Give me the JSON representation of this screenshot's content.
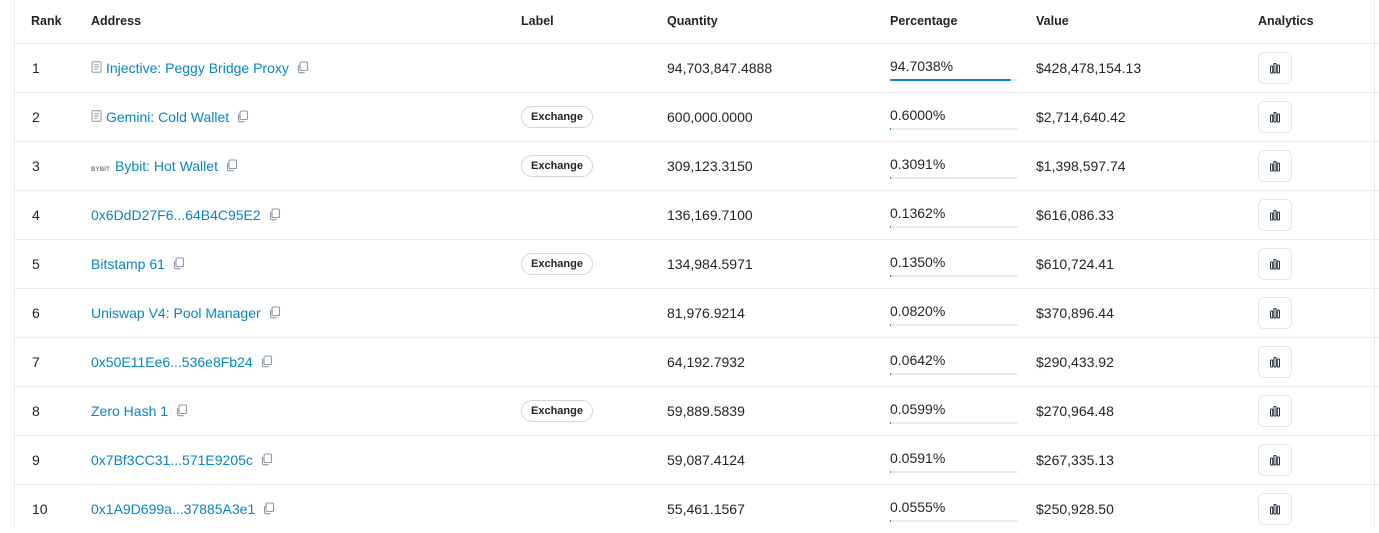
{
  "table": {
    "headers": {
      "rank": "Rank",
      "address": "Address",
      "label": "Label",
      "quantity": "Quantity",
      "percentage": "Percentage",
      "value": "Value",
      "analytics": "Analytics"
    },
    "rows": [
      {
        "rank": "1",
        "address": "Injective: Peggy Bridge Proxy",
        "icon": "contract-icon",
        "label": "",
        "quantity": "94,703,847.4888",
        "percentage": "94.7038%",
        "pct_value": 94.7038,
        "value": "$428,478,154.13"
      },
      {
        "rank": "2",
        "address": "Gemini: Cold Wallet",
        "icon": "contract-icon",
        "label": "Exchange",
        "quantity": "600,000.0000",
        "percentage": "0.6000%",
        "pct_value": 0.6,
        "value": "$2,714,640.42"
      },
      {
        "rank": "3",
        "address": "Bybit: Hot Wallet",
        "icon": "bybit-logo",
        "label": "Exchange",
        "quantity": "309,123.3150",
        "percentage": "0.3091%",
        "pct_value": 0.3091,
        "value": "$1,398,597.74"
      },
      {
        "rank": "4",
        "address": "0x6DdD27F6...64B4C95E2",
        "icon": "",
        "label": "",
        "quantity": "136,169.7100",
        "percentage": "0.1362%",
        "pct_value": 0.1362,
        "value": "$616,086.33"
      },
      {
        "rank": "5",
        "address": "Bitstamp 61",
        "icon": "",
        "label": "Exchange",
        "quantity": "134,984.5971",
        "percentage": "0.1350%",
        "pct_value": 0.135,
        "value": "$610,724.41"
      },
      {
        "rank": "6",
        "address": "Uniswap V4: Pool Manager",
        "icon": "",
        "label": "",
        "quantity": "81,976.9214",
        "percentage": "0.0820%",
        "pct_value": 0.082,
        "value": "$370,896.44"
      },
      {
        "rank": "7",
        "address": "0x50E11Ee6...536e8Fb24",
        "icon": "",
        "label": "",
        "quantity": "64,192.7932",
        "percentage": "0.0642%",
        "pct_value": 0.0642,
        "value": "$290,433.92"
      },
      {
        "rank": "8",
        "address": "Zero Hash 1",
        "icon": "",
        "label": "Exchange",
        "quantity": "59,889.5839",
        "percentage": "0.0599%",
        "pct_value": 0.0599,
        "value": "$270,964.48"
      },
      {
        "rank": "9",
        "address": "0x7Bf3CC31...571E9205c",
        "icon": "",
        "label": "",
        "quantity": "59,087.4124",
        "percentage": "0.0591%",
        "pct_value": 0.0591,
        "value": "$267,335.13"
      },
      {
        "rank": "10",
        "address": "0x1A9D699a...37885A3e1",
        "icon": "",
        "label": "",
        "quantity": "55,461.1567",
        "percentage": "0.0555%",
        "pct_value": 0.0555,
        "value": "$250,928.50"
      }
    ]
  },
  "colors": {
    "link": "#0784c3",
    "border": "#e9ecef",
    "progress_fill": "#0784c3"
  },
  "icons": {
    "copy": "copy-icon",
    "analytics": "bar-chart-icon",
    "contract": "contract-icon"
  }
}
